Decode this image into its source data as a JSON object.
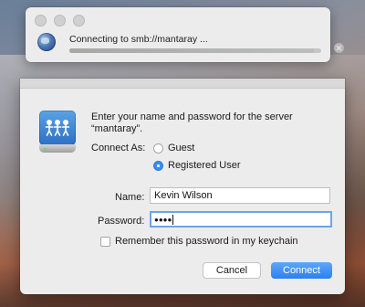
{
  "connecting_window": {
    "title": "Connecting to smb://mantaray ...",
    "progress": 0.97
  },
  "login_dialog": {
    "prompt": "Enter your name and password for the server “mantaray”.",
    "connect_as_label": "Connect As:",
    "options": [
      {
        "label": "Guest",
        "selected": false
      },
      {
        "label": "Registered User",
        "selected": true
      }
    ],
    "name_label": "Name:",
    "name_value": "Kevin Wilson",
    "password_label": "Password:",
    "password_mask": "●●●●",
    "remember_label": "Remember this password in my keychain",
    "remember_checked": false,
    "cancel_label": "Cancel",
    "connect_label": "Connect"
  },
  "colors": {
    "accent": "#3b8ef0",
    "primary_button": "#2d7ff0"
  },
  "icons": [
    "globe-icon",
    "network-server-icon",
    "stop-icon"
  ]
}
